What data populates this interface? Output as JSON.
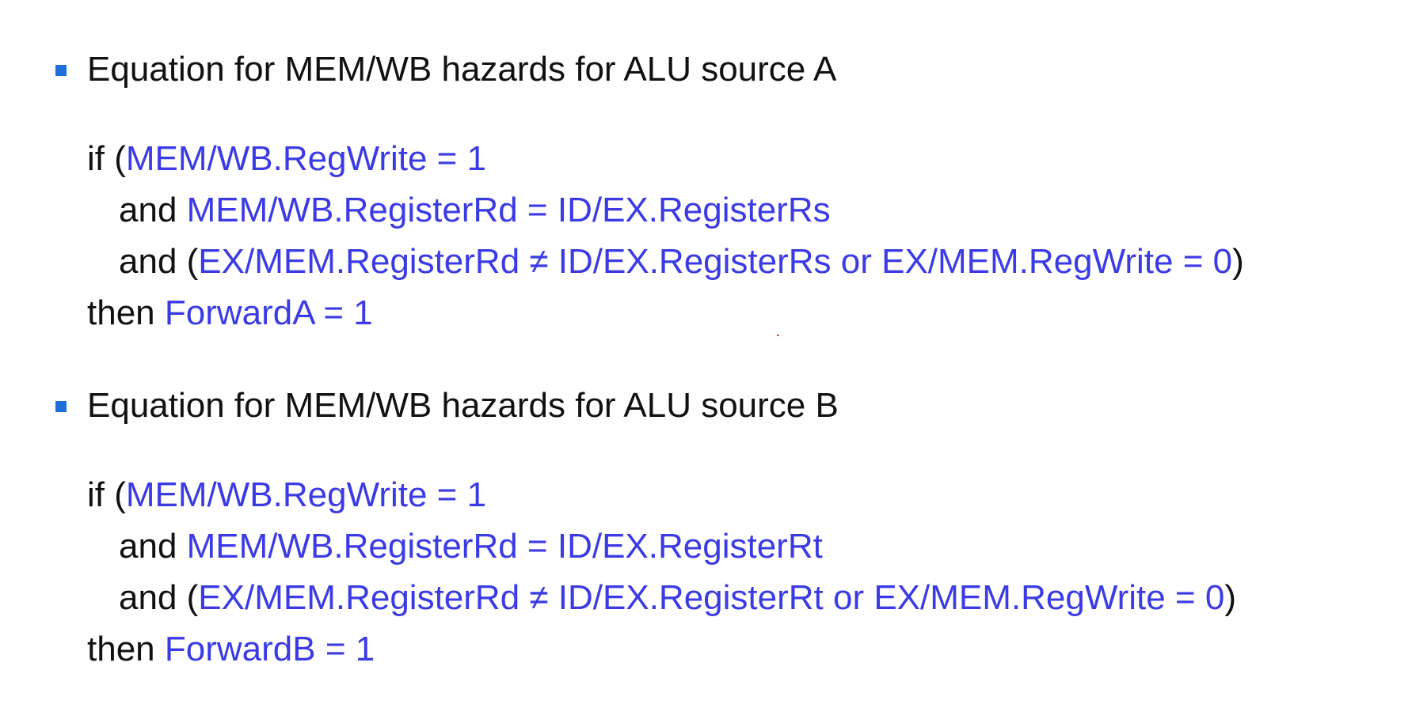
{
  "sections": [
    {
      "heading": "Equation for MEM/WB hazards for ALU source A",
      "line1": {
        "kw1": "if (",
        "cond": "MEM/WB.RegWrite = 1"
      },
      "line2": {
        "kw1": "and ",
        "cond": "MEM/WB.RegisterRd = ID/EX.RegisterRs"
      },
      "line3": {
        "kw1": "and (",
        "cond": "EX/MEM.RegisterRd ≠ ID/EX.RegisterRs or EX/MEM.RegWrite = 0",
        "close": ")"
      },
      "line4": {
        "kw1": "then ",
        "cond": "ForwardA = 1"
      }
    },
    {
      "heading": "Equation for MEM/WB hazards for ALU source B",
      "line1": {
        "kw1": "if (",
        "cond": "MEM/WB.RegWrite = 1"
      },
      "line2": {
        "kw1": "and ",
        "cond": "MEM/WB.RegisterRd = ID/EX.RegisterRt"
      },
      "line3": {
        "kw1": "and (",
        "cond": "EX/MEM.RegisterRd ≠ ID/EX.RegisterRt or EX/MEM.RegWrite = 0",
        "close": ")"
      },
      "line4": {
        "kw1": "then ",
        "cond": "ForwardB = 1"
      }
    }
  ],
  "colors": {
    "bullet": "#1e6fd9",
    "highlight": "#3b3be6",
    "text": "#111111"
  }
}
